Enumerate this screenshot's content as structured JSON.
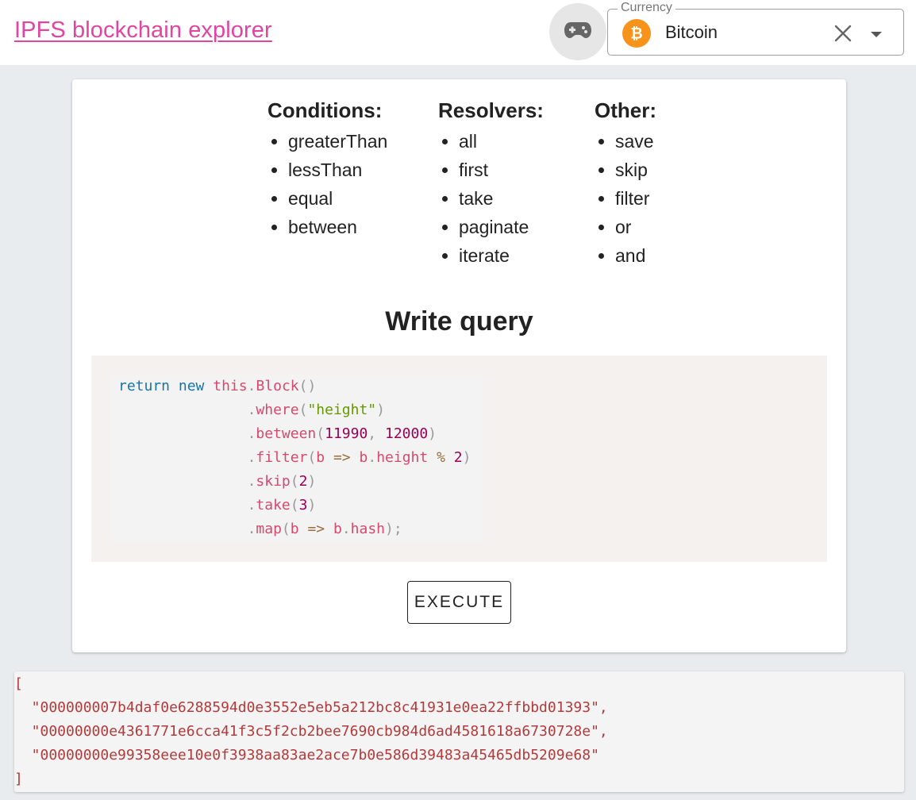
{
  "header": {
    "title": "IPFS blockchain explorer",
    "game_icon": "gamepad-icon",
    "currency": {
      "label": "Currency",
      "value": "Bitcoin",
      "icon": "bitcoin-icon",
      "clear_icon": "close-icon",
      "dropdown_icon": "arrow-drop-down-icon"
    }
  },
  "reference": {
    "columns": [
      {
        "heading": "Conditions:",
        "items": [
          "greaterThan",
          "lessThan",
          "equal",
          "between"
        ]
      },
      {
        "heading": "Resolvers:",
        "items": [
          "all",
          "first",
          "take",
          "paginate",
          "iterate"
        ]
      },
      {
        "heading": "Other:",
        "items": [
          "save",
          "skip",
          "filter",
          "or",
          "and"
        ]
      }
    ]
  },
  "query": {
    "title": "Write query",
    "code_lines": [
      "return new this.Block()",
      "               .where(\"height\")",
      "               .between(11990, 12000)",
      "               .filter(b => b.height % 2)",
      "               .skip(2)",
      "               .take(3)",
      "               .map(b => b.hash);"
    ],
    "execute_label": "EXECUTE"
  },
  "result": {
    "lines": [
      "[",
      "  \"000000007b4daf0e6288594d0e3552e5eb5a212bc8c41931e0ea22ffbbd01393\",",
      "  \"00000000e4361771e6cca41f3c5f2cb2bee7690cb984d6ad4581618a6730728e\",",
      "  \"00000000e99358eee10e0f3938aa83ae2ace7b0e586d39483a45465db5209e68\"",
      "]"
    ]
  },
  "colors": {
    "link": "#e2459f",
    "bitcoin": "#f7931a",
    "background": "#e8ecef",
    "keyword": "#1a74a4",
    "function": "#d44a6d",
    "string": "#669900",
    "number": "#990055",
    "result_text": "#b33a3a"
  }
}
